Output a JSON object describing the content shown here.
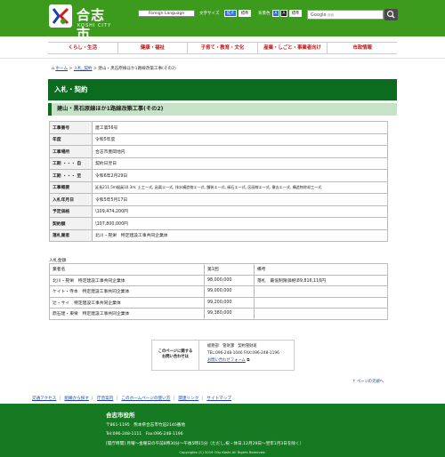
{
  "header": {
    "city_name": "合志市",
    "city_name_en": "KOSHI CITY",
    "language_select": "Foreign Language",
    "font_size_label": "文字サイズ",
    "font_size_large": "拡大",
    "font_size_standard": "標準",
    "bg_color_label": "背景色",
    "bg_color_a1": "A",
    "bg_color_a2": "A",
    "bg_color_standard": "標準",
    "search_logo": "Google",
    "search_placeholder": "検索"
  },
  "nav": {
    "items": [
      "くらし・生活",
      "健康・福祉",
      "子育て・教育・文化",
      "産業・しごと・事業者向け",
      "市政情報"
    ]
  },
  "breadcrumb": {
    "home": "ホーム",
    "c1": "入札_契約",
    "current": "建山・黒石原線ほか1路線改築工事(その2)"
  },
  "section_title": "入札・契約",
  "page_title": "建山・黒石原線ほか1路線改築工事(その2)",
  "details": [
    {
      "k": "工事番号",
      "v": "建工第56号"
    },
    {
      "k": "年度",
      "v": "令和5年度"
    },
    {
      "k": "工事場所",
      "v": "合志市豊岡地内"
    },
    {
      "k": "工期 ・・・ 自",
      "v": "契約日翌日"
    },
    {
      "k": "工期 ・・・ 至",
      "v": "令和6年2月29日"
    },
    {
      "k": "工事概要",
      "v": "延長211.5m幅員10.3m, 土工一式, 函渠エ一式, 排水構造物エ一式, 舗装エ一式, 縁石エ一式, 区画線エ一式, 撤去エ一式, 構造物除却工一式"
    },
    {
      "k": "入札年月日",
      "v": "令和5年5月17日"
    },
    {
      "k": "予定価格",
      "v": "\\109,474,200円"
    },
    {
      "k": "契約額",
      "v": "\\107,800,000円"
    },
    {
      "k": "落札業者",
      "v": "北川・晃栄　特定建設工事共同企業体"
    }
  ],
  "bids": {
    "label": "入札金額",
    "headers": [
      "業者名",
      "第1回",
      "備考"
    ],
    "rows": [
      {
        "name": "北川・晃栄　特定建設工事共同企業体",
        "amount": "98,000,000",
        "note": "落札　最低制限価格\\89,816,116円"
      },
      {
        "name": "ケイト・寺本　特定建設工事共同企業体",
        "amount": "99,000,000",
        "note": ""
      },
      {
        "name": "辻・サイ　特定建設工事共同企業体",
        "amount": "99,200,000",
        "note": ""
      },
      {
        "name": "鼎石建・東栄　特定建設工事共同企業体",
        "amount": "99,380,000",
        "note": ""
      }
    ]
  },
  "contact": {
    "heading_line1": "このページに関する",
    "heading_line2": "お問い合わせは",
    "dept": "総務部　管財課　契約管財班",
    "tel": "TEL:096-248-1046 FAX:096-248-1196",
    "form_link": "お問い合わせフォーム"
  },
  "page_top": "ページの先頭へ",
  "footer_links": [
    "交通アクセス",
    "組織から探す",
    "庁舎案内",
    "このホームページの使い方",
    "関連リンク",
    "サイトマップ"
  ],
  "footer": {
    "org": "合志市役所",
    "address": "〒861-1195　熊本県合志市竹迫2140番地",
    "tel": "Tel:096-248-1111　Fax:096-248-1196",
    "hours": "[開庁時間] 月曜～金曜日の午前8時30分～午後5時15分（ただし,祝・休日,12月29日～翌年1月3日を除く）",
    "copyright": "Copyrights (C) 2019 City Koshi All Rights Reserved."
  },
  "colors": {
    "brand_green": "#3c9a1c",
    "dark_green": "#0b6b1e",
    "nav_red": "#c01818",
    "link_blue": "#1a3fb0"
  }
}
